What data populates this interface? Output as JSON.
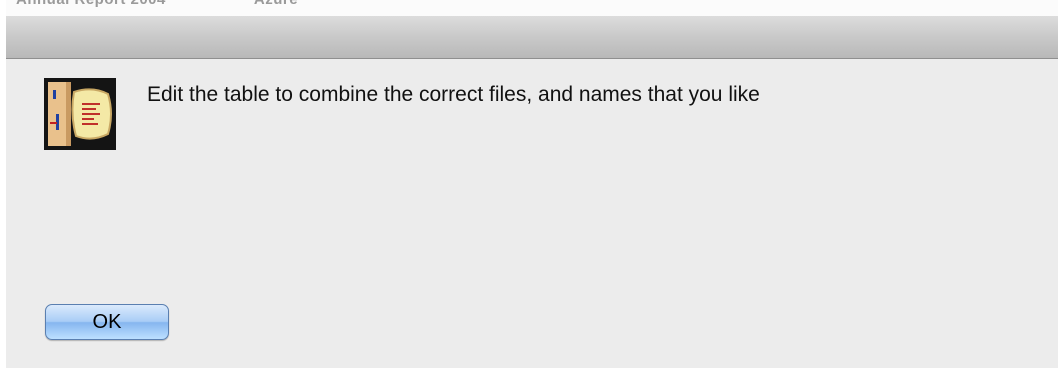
{
  "dialog": {
    "message": "Edit the table to combine the correct files, and names that you like",
    "icon": "script-editor-icon",
    "ok_label": "OK"
  },
  "colors": {
    "body_background": "#ececec",
    "button_blue": "#a9cdf6"
  }
}
